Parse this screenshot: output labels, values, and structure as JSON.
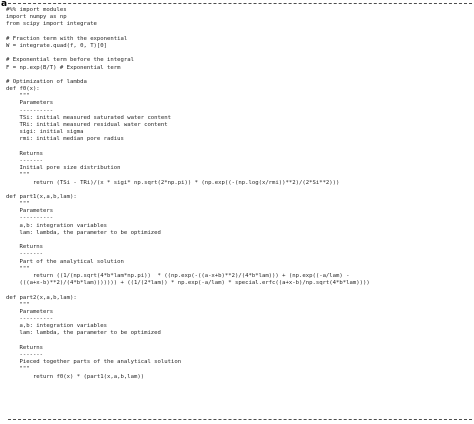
{
  "panel_label": "a",
  "code_lines": [
    "#%% import modules",
    "import numpy as np",
    "from scipy import integrate",
    "",
    "# Fraction term with the exponential",
    "W = integrate.quad(f, 0, T)[0]",
    "",
    "# Exponential term before the integral",
    "F = np.exp(B/T) # Exponential term",
    "",
    "# Optimization of lambda",
    "def f0(x):",
    "    \"\"\"",
    "    Parameters",
    "    ----------",
    "    TSi: initial measured saturated water content",
    "    TRi: initial measured residual water content",
    "    sigi: initial sigma",
    "    rmi: initial median pore radius",
    "",
    "    Returns",
    "    -------",
    "    Initial pore size distribution",
    "    \"\"\"",
    "        return (TSi - TRi)/(x * sigi* np.sqrt(2*np.pi)) * (np.exp((-(np.log(x/rmi))**2)/(2*Si**2)))",
    "",
    "def part1(x,a,b,lam):",
    "    \"\"\"",
    "    Parameters",
    "    ----------",
    "    a,b: integration variables",
    "    lam: lambda, the parameter to be optimized",
    "",
    "    Returns",
    "    -------",
    "    Part of the analytical solution",
    "    \"\"\"",
    "        return ((1/(np.sqrt(4*b*lam*np.pi))  * ((np.exp(-((a-x+b)**2)/(4*b*lam))) + (np.exp((-a/lam) -",
    "    (((a+x-b)**2)/(4*b*lam))))))) + ((1/(2*lam)) * np.exp(-a/lam) * special.erfc((a+x-b)/np.sqrt(4*b*lam))))",
    "",
    "def part2(x,a,b,lam):",
    "    \"\"\"",
    "    Parameters",
    "    ----------",
    "    a,b: integration variables",
    "    lam: lambda, the parameter to be optimized",
    "",
    "    Returns",
    "    -------",
    "    Pieced together parts of the analytical solution",
    "    \"\"\"",
    "        return f0(x) * (part1(x,a,b,lam))"
  ]
}
